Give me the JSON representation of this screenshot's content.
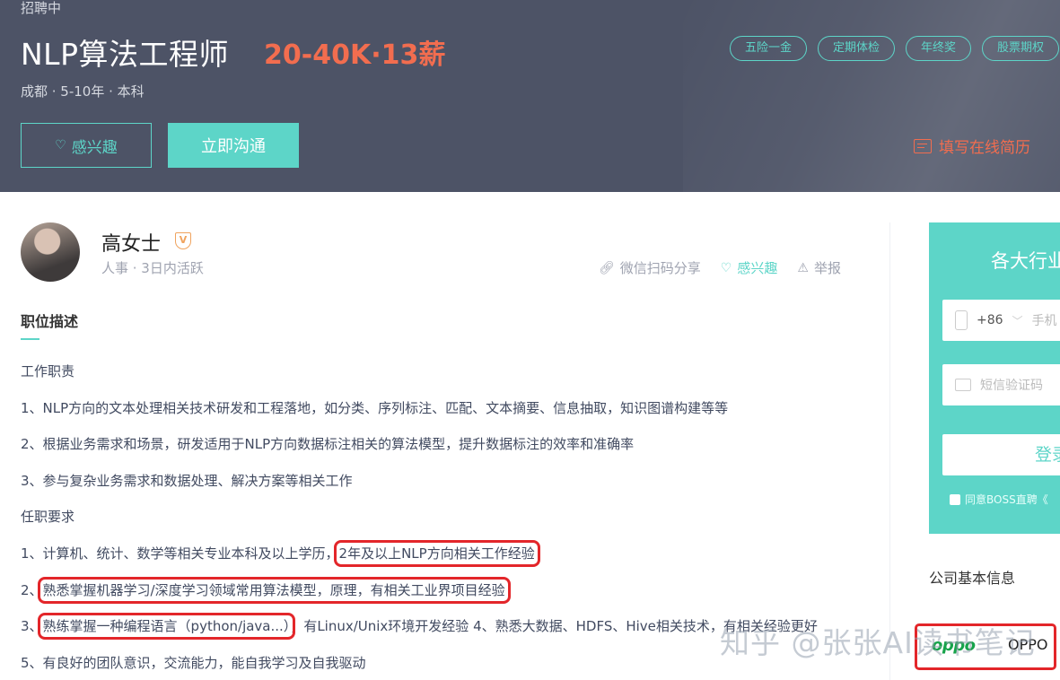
{
  "header": {
    "status": "招聘中",
    "job_title": "NLP算法工程师",
    "salary": "20-40K·13薪",
    "meta": "成都 · 5-10年 · 本科",
    "tags": [
      "五险一金",
      "定期体检",
      "年终奖",
      "股票期权"
    ],
    "interest_label": "感兴趣",
    "chat_label": "立即沟通",
    "resume_label": "填写在线简历"
  },
  "recruiter": {
    "name": "高女士",
    "verify_badge": "V",
    "meta": "人事 · 3日内活跃",
    "share_label": "微信扫码分享",
    "interest_label": "感兴趣",
    "report_label": "举报"
  },
  "description": {
    "title": "职位描述",
    "duty_heading": "工作职责",
    "duties": [
      "1、NLP方向的文本处理相关技术研发和工程落地，如分类、序列标注、匹配、文本摘要、信息抽取，知识图谱构建等等",
      "2、根据业务需求和场景，研发适用于NLP方向数据标注相关的算法模型，提升数据标注的效率和准确率",
      "3、参与复杂业务需求和数据处理、解决方案等相关工作"
    ],
    "req_heading": "任职要求",
    "req1": {
      "prefix": "1、计算机、统计、数学等相关专业本科及以上学历，",
      "highlight": "2年及以上NLP方向相关工作经验"
    },
    "req2": {
      "prefix": "2、",
      "highlight": "熟悉掌握机器学习/深度学习领域常用算法模型，原理，有相关工业界项目经验"
    },
    "req3": {
      "prefix": "3、",
      "highlight": "熟练掌握一种编程语言（python/java...）",
      "suffix": "，有Linux/Unix环境开发经验 4、熟悉大数据、HDFS、Hive相关技术，有相关经验更好"
    },
    "req5": "5、有良好的团队意识，交流能力，能自我学习及自我驱动"
  },
  "side": {
    "title": "各大行业",
    "country_code": "+86",
    "phone_placeholder": "手机",
    "sms_placeholder": "短信验证码",
    "login_label": "登录",
    "agree_text": "同意BOSS直聘《",
    "company_heading": "公司基本信息",
    "company_logo_text": "oppo",
    "company_name": "OPPO"
  },
  "watermark": "知乎 @张张AI读书笔记",
  "colors": {
    "accent": "#5dd5c8",
    "salary": "#f26d4f",
    "header_bg": "#4d5366",
    "highlight_box": "#e3262a"
  }
}
